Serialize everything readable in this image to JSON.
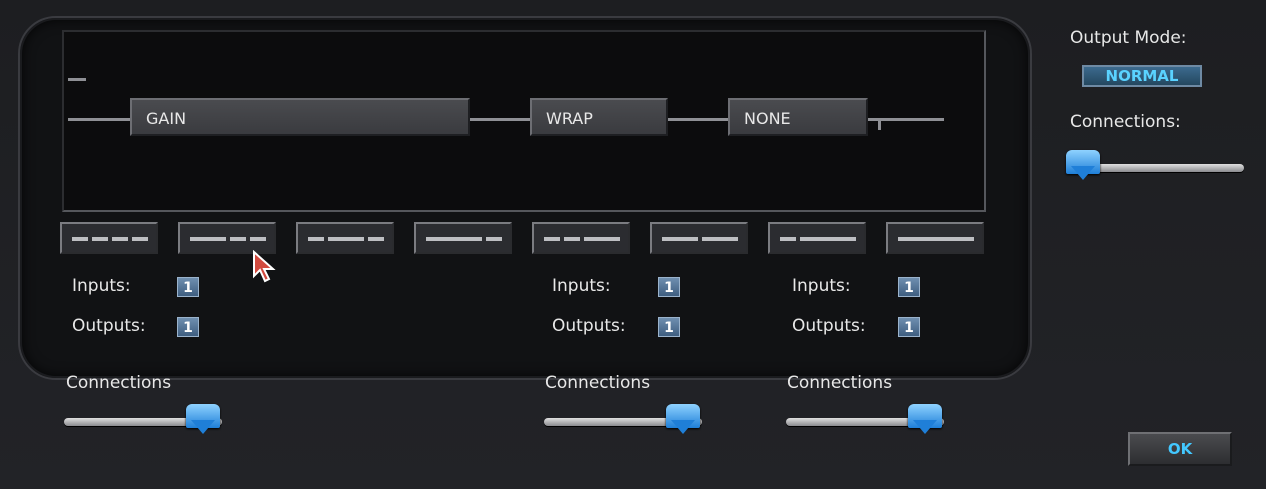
{
  "routing": {
    "blocks": [
      "GAIN",
      "WRAP",
      "NONE"
    ]
  },
  "presets": [
    {
      "segments": 4
    },
    {
      "segments": 3
    },
    {
      "segments": 3
    },
    {
      "segments": 2
    },
    {
      "segments": 3
    },
    {
      "segments": 2
    },
    {
      "segments": 2
    },
    {
      "segments": 1
    }
  ],
  "io_groups": [
    {
      "inputs_label": "Inputs:",
      "inputs_value": "1",
      "outputs_label": "Outputs:",
      "outputs_value": "1"
    },
    {
      "inputs_label": "Inputs:",
      "inputs_value": "1",
      "outputs_label": "Outputs:",
      "outputs_value": "1"
    },
    {
      "inputs_label": "Inputs:",
      "inputs_value": "1",
      "outputs_label": "Outputs:",
      "outputs_value": "1"
    }
  ],
  "connections": [
    {
      "label": "Connections",
      "level": 0.85
    },
    {
      "label": "Connections",
      "level": 0.85
    },
    {
      "label": "Connections",
      "level": 0.85
    }
  ],
  "side": {
    "output_mode_label": "Output Mode:",
    "output_mode_value": "NORMAL",
    "connections_label": "Connections:",
    "connections_level": 0.0
  },
  "ok_label": "OK",
  "icons": [
    "cursor-arrow-icon"
  ]
}
